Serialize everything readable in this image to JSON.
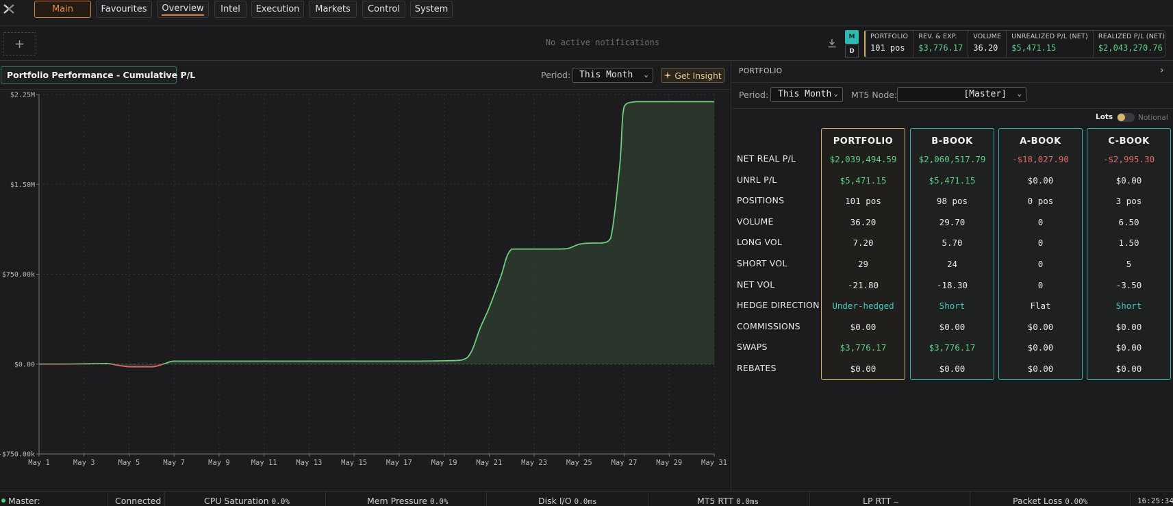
{
  "nav": {
    "tabs": [
      {
        "label": "Main",
        "state": "active"
      },
      {
        "label": "Favourites"
      },
      {
        "label": "Overview",
        "state": "underlined"
      },
      {
        "label": "Intel"
      },
      {
        "label": "Execution"
      },
      {
        "label": "Markets"
      },
      {
        "label": "Control"
      },
      {
        "label": "System"
      }
    ],
    "logo_icon": "x-logo-icon"
  },
  "notifications": {
    "add_label": "+",
    "empty_text": "No active notifications",
    "mode_m": "M",
    "mode_d": "D",
    "summary": [
      {
        "label": "PORTFOLIO",
        "value": "101 pos",
        "tone": "white"
      },
      {
        "label": "REV. & EXP.",
        "value": "$3,776.17",
        "tone": "green"
      },
      {
        "label": "VOLUME",
        "value": "36.20",
        "tone": "white"
      },
      {
        "label": "UNREALIZED P/L (NET)",
        "value": "$5,471.15",
        "tone": "green"
      },
      {
        "label": "REALIZED P/L (NET)",
        "value": "$2,043,270.76",
        "tone": "green"
      }
    ]
  },
  "chart_panel": {
    "title": "Portfolio Performance - Cumulative P/L",
    "period_label": "Period:",
    "period_value": "This Month",
    "insight_label": "Get Insight"
  },
  "chart_data": {
    "type": "area",
    "title": "Portfolio Performance - Cumulative P/L",
    "ylim": [
      -750000,
      2250000
    ],
    "y_ticks": [
      -750000,
      0,
      750000,
      1500000,
      2250000
    ],
    "y_tick_labels": [
      "-$750.00k",
      "$0.00",
      "$750.00k",
      "$1.50M",
      "$2.25M"
    ],
    "x_range": [
      1,
      31
    ],
    "x_tick_labels": [
      "May 1",
      "May 3",
      "May 5",
      "May 7",
      "May 9",
      "May 11",
      "May 13",
      "May 15",
      "May 17",
      "May 19",
      "May 21",
      "May 23",
      "May 25",
      "May 27",
      "May 29",
      "May 31"
    ],
    "grid": true,
    "series": [
      {
        "x": [
          1,
          2,
          3,
          4,
          4.5,
          5,
          5.5,
          6,
          6.2,
          6.6,
          7,
          8,
          10,
          12,
          14,
          16,
          18,
          19,
          19.8,
          20.2,
          20.6,
          21,
          21.5,
          22,
          23,
          24,
          24.5,
          25,
          25.5,
          26,
          26.4,
          26.8,
          27,
          27.5,
          28,
          29,
          30,
          31
        ],
        "y": [
          0,
          0,
          2000,
          5000,
          -10000,
          -22000,
          -23000,
          -23000,
          -18000,
          5000,
          25000,
          25000,
          25000,
          25000,
          25000,
          25000,
          25000,
          28000,
          35000,
          100000,
          300000,
          470000,
          720000,
          960000,
          960000,
          960000,
          965000,
          1000000,
          1010000,
          1010000,
          1050000,
          1650000,
          2150000,
          2190000,
          2190000,
          2190000,
          2190000,
          2190000
        ],
        "positive_color": "#6fcf7f",
        "negative_color": "#e06a6a",
        "fill_color": "#2c3a2e"
      }
    ]
  },
  "portfolio_panel": {
    "title": "PORTFOLIO",
    "period_label": "Period:",
    "period_value": "This Month",
    "mt5_label": "MT5 Node:",
    "mt5_value": "[Master]",
    "lots_label": "Lots",
    "notional_label": "Notional",
    "row_labels": [
      "NET REAL P/L",
      "UNRL P/L",
      "POSITIONS",
      "VOLUME",
      "LONG VOL",
      "SHORT VOL",
      "NET VOL",
      "HEDGE DIRECTION",
      "COMMISSIONS",
      "SWAPS",
      "REBATES"
    ],
    "books": [
      {
        "name": "PORTFOLIO",
        "values": [
          "$2,039,494.59",
          "$5,471.15",
          "101 pos",
          "36.20",
          "7.20",
          "29",
          "-21.80",
          "Under-hedged",
          "$0.00",
          "$3,776.17",
          "$0.00"
        ],
        "tones": [
          "green",
          "green",
          "white",
          "white",
          "white",
          "white",
          "white",
          "teal",
          "white",
          "green",
          "white"
        ]
      },
      {
        "name": "B-BOOK",
        "values": [
          "$2,060,517.79",
          "$5,471.15",
          "98 pos",
          "29.70",
          "5.70",
          "24",
          "-18.30",
          "Short",
          "$0.00",
          "$3,776.17",
          "$0.00"
        ],
        "tones": [
          "green",
          "green",
          "white",
          "white",
          "white",
          "white",
          "white",
          "teal",
          "white",
          "green",
          "white"
        ]
      },
      {
        "name": "A-BOOK",
        "values": [
          "-$18,027.90",
          "$0.00",
          "0 pos",
          "0",
          "0",
          "0",
          "0",
          "Flat",
          "$0.00",
          "$0.00",
          "$0.00"
        ],
        "tones": [
          "red",
          "white",
          "white",
          "white",
          "white",
          "white",
          "white",
          "white",
          "white",
          "white",
          "white"
        ]
      },
      {
        "name": "C-BOOK",
        "values": [
          "-$2,995.30",
          "$0.00",
          "3 pos",
          "6.50",
          "1.50",
          "5",
          "-3.50",
          "Short",
          "$0.00",
          "$0.00",
          "$0.00"
        ],
        "tones": [
          "red",
          "white",
          "white",
          "white",
          "white",
          "white",
          "white",
          "teal",
          "white",
          "white",
          "white"
        ]
      }
    ]
  },
  "status_bar": {
    "master_label": "Master:",
    "connection": "Connected",
    "cpu_label": "CPU Saturation",
    "cpu_value": "0.0%",
    "mem_label": "Mem Pressure",
    "mem_value": "0.0%",
    "disk_label": "Disk I/O",
    "disk_value": "0.0ms",
    "mt5_label": "MT5 RTT",
    "mt5_value": "0.0ms",
    "lp_label": "LP RTT",
    "lp_value": "—",
    "packet_label": "Packet Loss",
    "packet_value": "0.00%",
    "clock": "16:25:34"
  },
  "colors": {
    "accent_orange": "#d9823a",
    "accent_teal": "#2fb9b3",
    "accent_gold": "#d8b36e",
    "positive": "#5fcf8a",
    "negative": "#e06a6a"
  }
}
